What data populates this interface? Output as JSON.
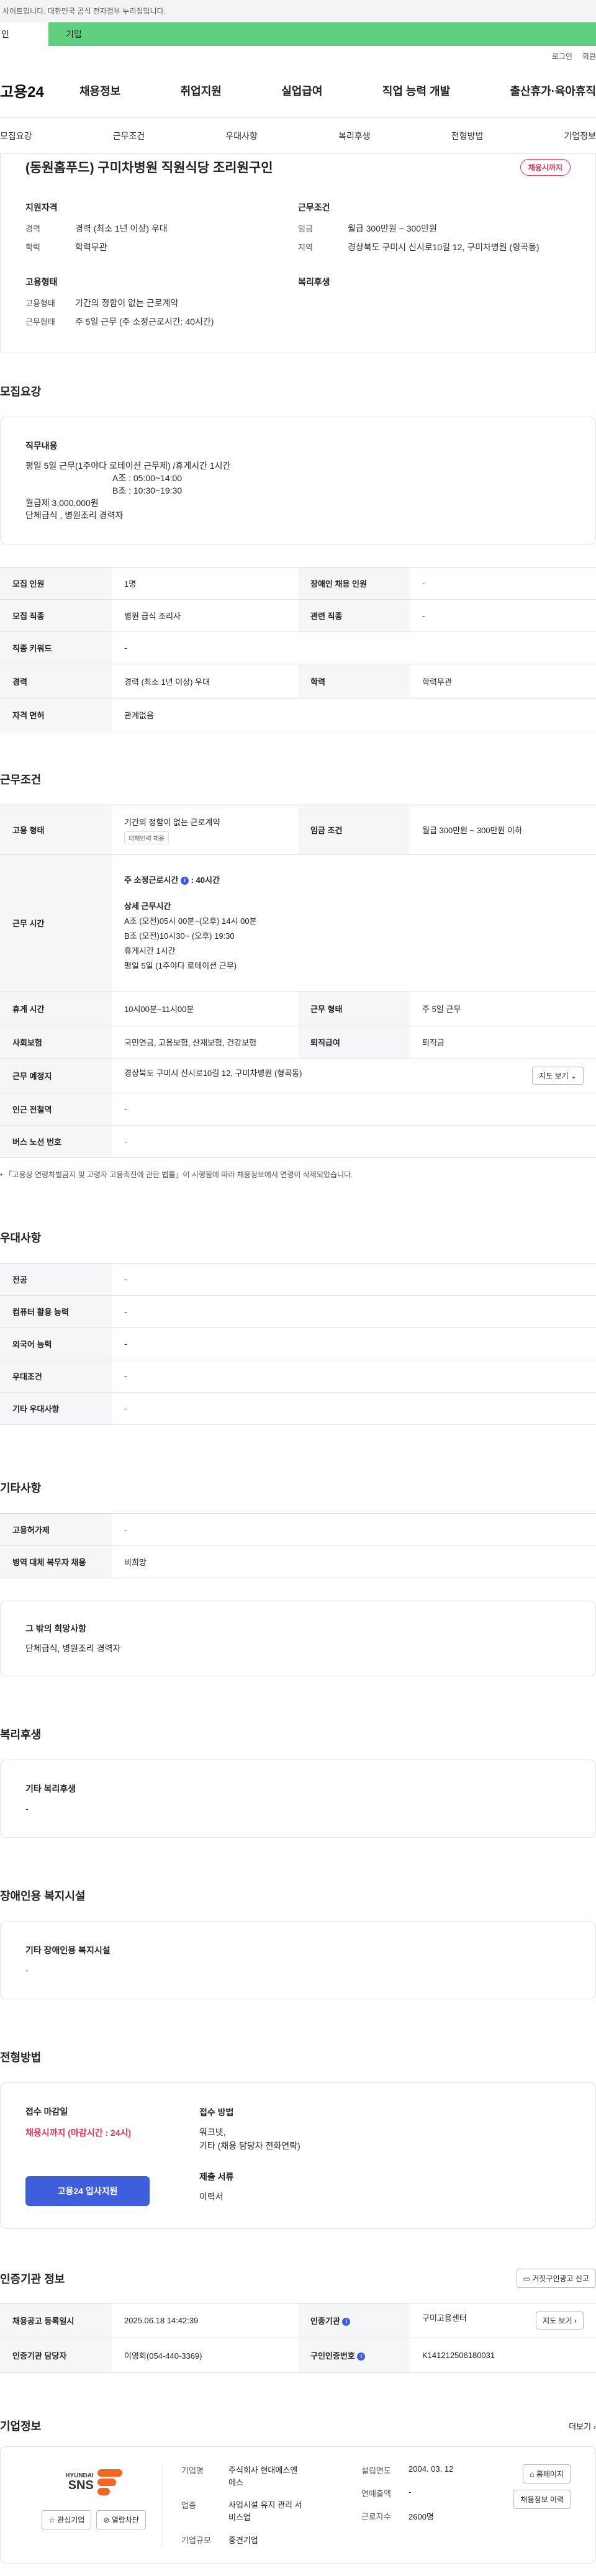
{
  "gov_banner": "사이트입니다. 대한민국 공식 전자정부 누리집입니다.",
  "top_tabs": [
    "인",
    "기업"
  ],
  "util": [
    "로그인",
    "회원"
  ],
  "logo": "고용24",
  "gnb": [
    "채용정보",
    "취업지원",
    "실업급여",
    "직업 능력 개발",
    "출산휴가·육아휴직"
  ],
  "subnav": [
    "모집요강",
    "근무조건",
    "우대사항",
    "복리후생",
    "전형방법",
    "기업정보"
  ],
  "title": "(동원홈푸드) 구미차병원 직원식당 조리원구인",
  "badge": "채용시까지",
  "summary": {
    "req_h": "지원자격",
    "cond_h": "근무조건",
    "emp_h": "고용형태",
    "welfare_h": "복리후생",
    "career_k": "경력",
    "career_v": "경력 (최소 1년 이상) 우대",
    "edu_k": "학력",
    "edu_v": "학력무관",
    "wage_k": "임금",
    "wage_v": "월급 300만원 ~ 300만원",
    "loc_k": "지역",
    "loc_v": "경상북도 구미시 신시로10길 12, 구미차병원 (형곡동)",
    "emptype_k": "고용형태",
    "emptype_v": "기간의 정함이 없는 근로계약",
    "worktype_k": "근무형태",
    "worktype_v": "주 5일 근무 (주 소정근로시간: 40시간)"
  },
  "recruit": {
    "h": "모집요강",
    "duty_title": "직무내용",
    "duty_lines": [
      "평일 5일 근무(1주야다 로테이션 근무제) /휴게시간 1시간",
      "A조 : 05:00~14:00",
      "B조 : 10:30~19:30",
      "월급제 3,000,000원",
      "단체급식 , 병원조리 경력자"
    ],
    "rows": [
      {
        "k1": "모집 인원",
        "v1": "1명",
        "k2": "장애인 채용 인원",
        "v2": "-"
      },
      {
        "k1": "모집 직종",
        "v1": "병원 급식 조리사",
        "k2": "관련 직종",
        "v2": "-"
      },
      {
        "k1": "직종 키워드",
        "v1": "-"
      },
      {
        "k1": "경력",
        "v1": "경력 (최소 1년 이상) 우대",
        "k2": "학력",
        "v2": "학력무관"
      },
      {
        "k1": "자격 면허",
        "v1": "관계없음"
      }
    ]
  },
  "conditions": {
    "h": "근무조건",
    "emptype_k": "고용 형태",
    "emptype_v": "기간의 정함이 없는 근로계약",
    "emptype_tag": "대체인력 채용",
    "wage_k": "임금 조건",
    "wage_v": "월급 300만원 ~ 300만원 이하",
    "hours_k": "근무 시간",
    "hours_main": "주 소정근로시간",
    "hours_main_v": ": 40시간",
    "hours_detail_h": "상세 근무시간",
    "hours_lines": [
      "A조 (오전)05시 00분~(오후) 14시 00분",
      "B조 (오전)10시30~ (오후) 19:30",
      "휴게시간 1시간",
      "평일 5일 (1주야다 로테이션 근무)"
    ],
    "break_k": "휴게 시간",
    "break_v": "10시00분~11시00분",
    "worktype_k": "근무 형태",
    "worktype_v": "주 5일 근무",
    "ins_k": "사회보험",
    "ins_v": "국민연금, 고용보험, 산재보험, 건강보험",
    "ret_k": "퇴직급여",
    "ret_v": "퇴직금",
    "place_k": "근무 예정지",
    "place_v": "경상북도 구미시 신시로10길 12, 구미차병원 (형곡동)",
    "map_btn": "지도 보기",
    "subway_k": "인근 전철역",
    "subway_v": "-",
    "bus_k": "버스 노선 번호",
    "bus_v": "-",
    "note": "「고용상 연령차별금지 및 고령자 고용촉진에 관한 법률」이 시행됨에 따라 채용정보에서 연령이 삭제되었습니다."
  },
  "pref": {
    "h": "우대사항",
    "rows": [
      {
        "k": "전공",
        "v": "-"
      },
      {
        "k": "컴퓨터 활용 능력",
        "v": "-"
      },
      {
        "k": "외국어 능력",
        "v": "-"
      },
      {
        "k": "우대조건",
        "v": "-"
      },
      {
        "k": "기타 우대사항",
        "v": "-"
      }
    ]
  },
  "etc": {
    "h": "기타사항",
    "rows": [
      {
        "k": "고용허가제",
        "v": "-"
      },
      {
        "k": "병역 대체 복무자 채용",
        "v": "비희망"
      }
    ],
    "box_title": "그 밖의 희망사항",
    "box_text": "단체급식, 병원조리 경력자"
  },
  "welfare": {
    "h": "복리후생",
    "box_title": "기타 복리후생",
    "box_text": "-"
  },
  "disabled": {
    "h": "장애인용 복지시설",
    "box_title": "기타 장애인용 복지시설",
    "box_text": "-"
  },
  "selection": {
    "h": "전형방법",
    "deadline_h": "접수 마감일",
    "deadline_v": "채용시까지 (마감시간 : 24시)",
    "method_h": "접수 방법",
    "method_lines": [
      "워크넷,",
      "기타 (채용 담당자 전화연락)"
    ],
    "docs_h": "제출 서류",
    "docs_v": "이력서",
    "apply_btn": "고용24 입사지원"
  },
  "agency": {
    "h": "인증기관 정보",
    "report_btn": "거짓구인광고 신고",
    "reg_k": "채용공고 등록일시",
    "reg_v": "2025.06.18 14:42:39",
    "org_k": "인증기관",
    "org_v": "구미고용센터",
    "map_btn": "지도 보기",
    "mgr_k": "인증기관 담당자",
    "mgr_v": "이영희(054-440-3369)",
    "cert_k": "구인인증번호",
    "cert_v": "K141212506180031"
  },
  "company": {
    "h": "기업정보",
    "more": "더보기",
    "logo_text_1": "HYUNDAI",
    "logo_text_2": "SNS",
    "fav_btn": "관심기업",
    "block_btn": "열람차단",
    "name_k": "기업명",
    "name_v": "주식회사 현대에스엔에스",
    "ind_k": "업종",
    "ind_v": "사업시설 유지 관리 서비스업",
    "size_k": "기업규모",
    "size_v": "중견기업",
    "est_k": "설립연도",
    "est_v": "2004. 03. 12",
    "sales_k": "연매출액",
    "sales_v": "-",
    "emp_k": "근로자수",
    "emp_v": "2600명",
    "home_btn": "홈페이지",
    "jobs_btn": "채용정보 이력"
  }
}
